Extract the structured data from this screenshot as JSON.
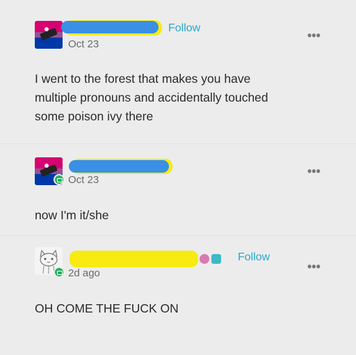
{
  "posts": [
    {
      "date": "Oct 23",
      "follow_label": "Follow",
      "more_label": "•••",
      "text_lines": [
        "I went to the forest that makes you have",
        "multiple pronouns and accidentally touched",
        "some poison ivy there"
      ]
    },
    {
      "date": "Oct 23",
      "more_label": "•••",
      "text_lines": [
        "now I'm it/she"
      ]
    },
    {
      "date": "2d ago",
      "follow_label": "Follow",
      "more_label": "•••",
      "text_lines": [
        "OH COME THE FUCK ON"
      ]
    }
  ],
  "colors": {
    "background": "#ececec",
    "follow": "#2ba8c8",
    "redaction_blue": "#3a8fe6",
    "redaction_yellow": "#f7eb12",
    "badge_green": "#1fb05a"
  },
  "icons": [
    "bi-flag-avatar",
    "sketch-cat-avatar",
    "green-badge-icon",
    "more-icon"
  ]
}
